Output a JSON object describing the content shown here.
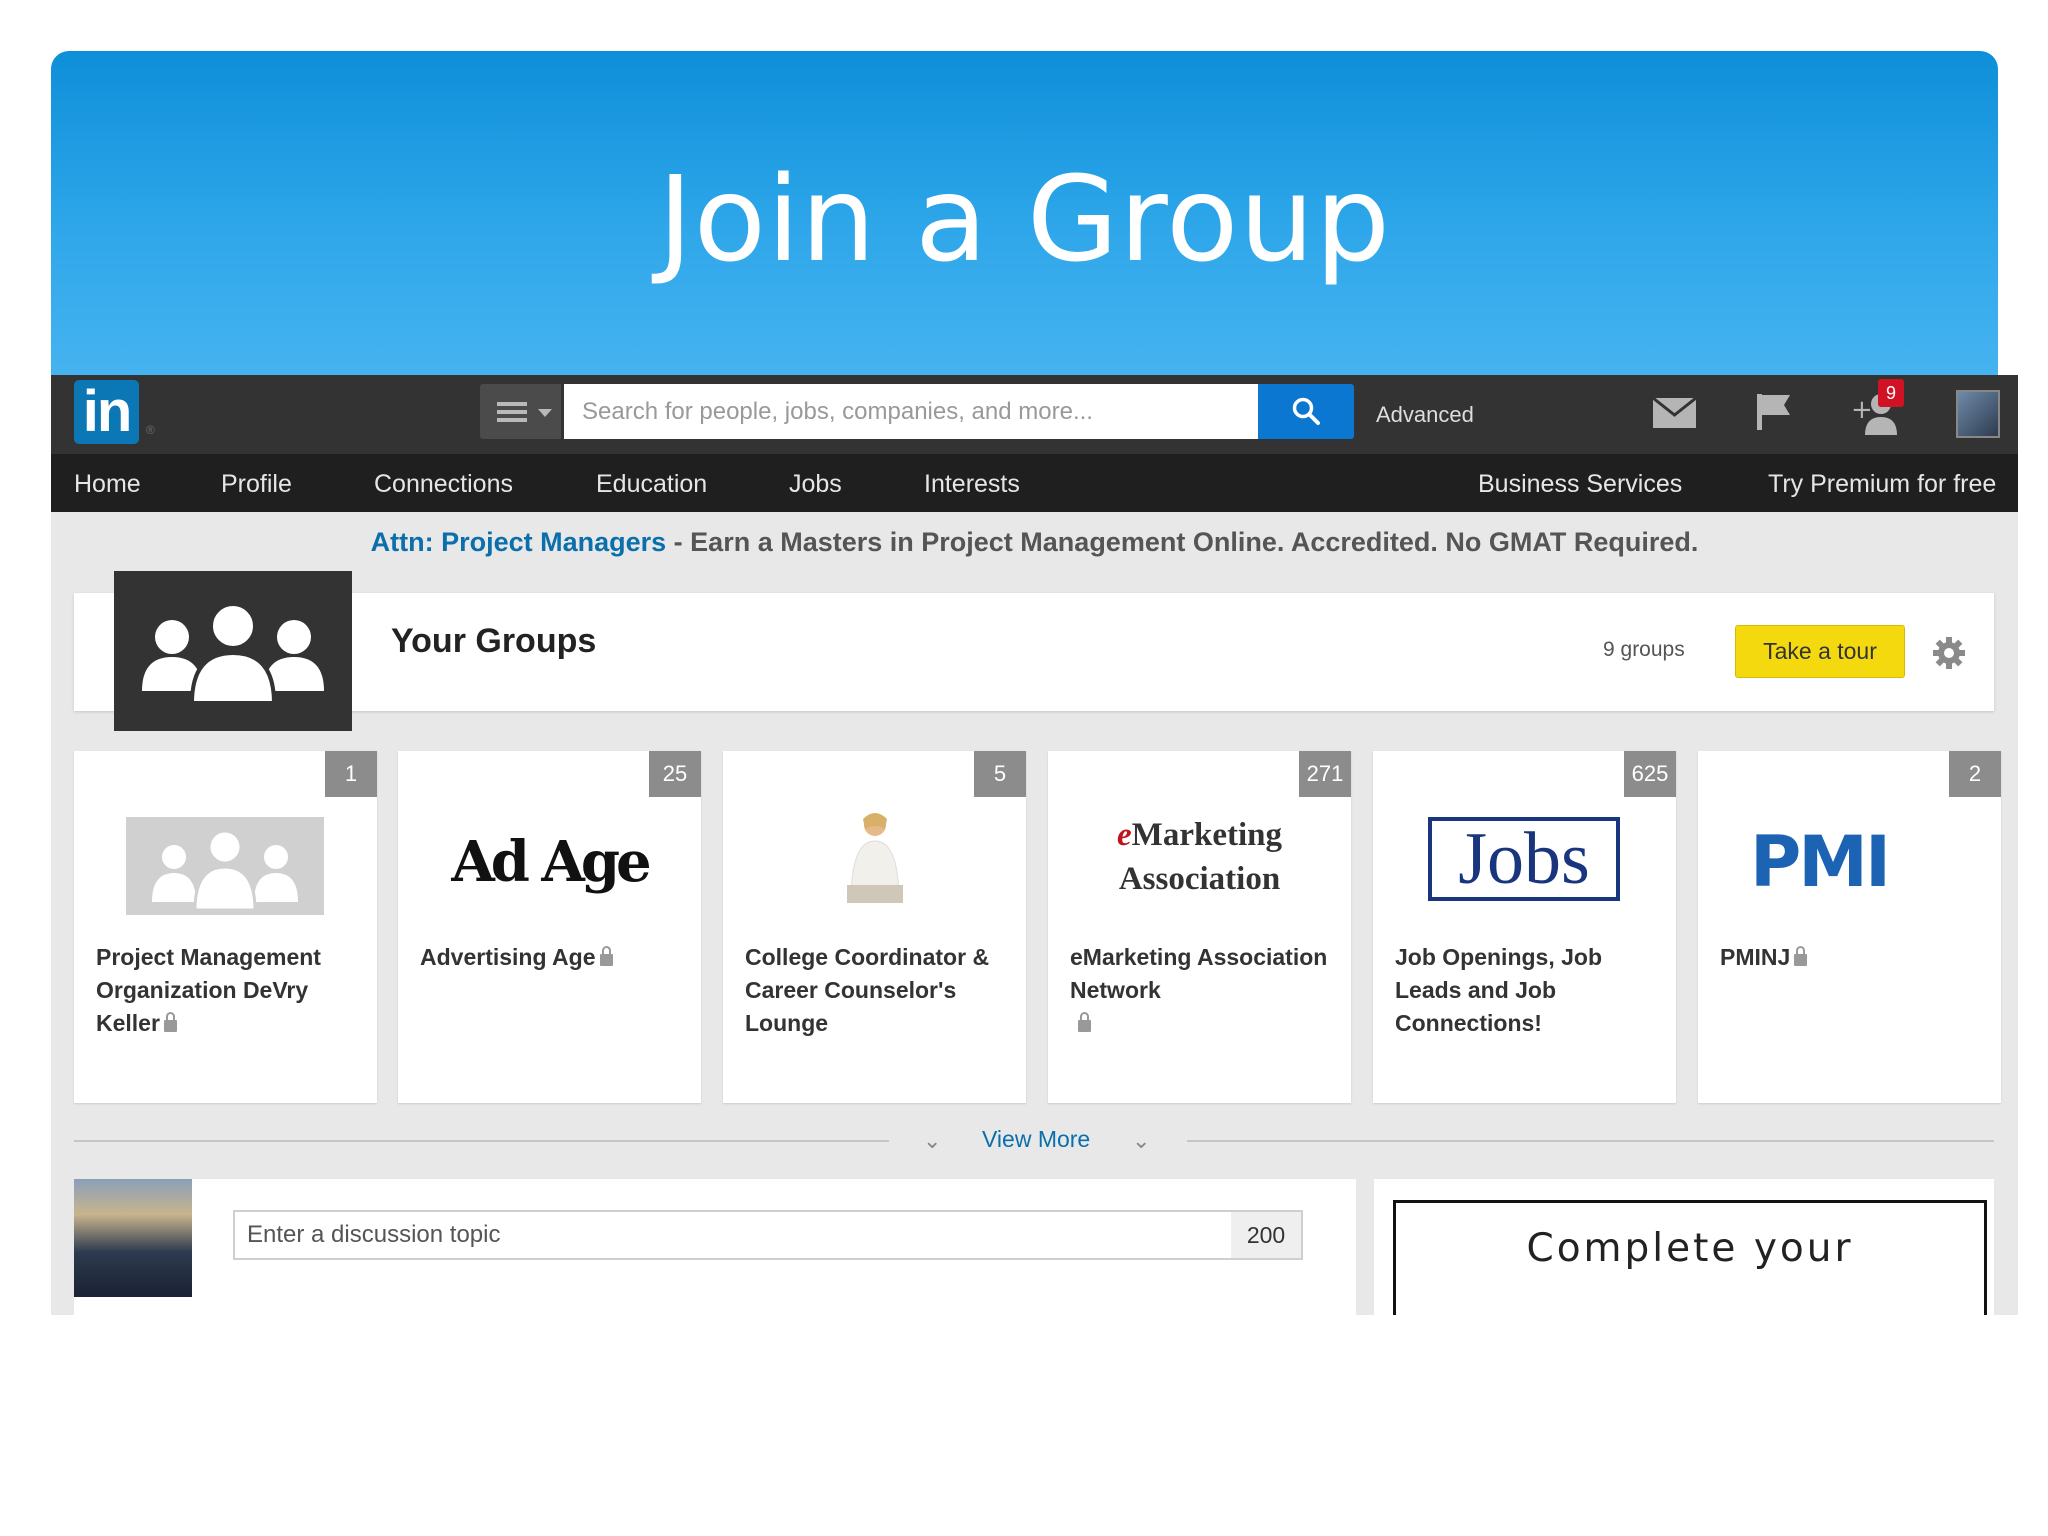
{
  "slide": {
    "title": "Join a Group"
  },
  "topbar": {
    "logo": "in",
    "logo_mark": "®",
    "search_placeholder": "Search for people, jobs, companies, and more...",
    "advanced_label": "Advanced",
    "notification_count": "9",
    "icons": [
      "menu-icon",
      "search-icon",
      "mail-icon",
      "flag-icon",
      "add-connection-icon",
      "profile-avatar"
    ]
  },
  "nav": {
    "home": "Home",
    "profile": "Profile",
    "connections": "Connections",
    "education": "Education",
    "jobs": "Jobs",
    "interests": "Interests",
    "business_services": "Business Services",
    "premium": "Try Premium for free"
  },
  "promo": {
    "link": "Attn: Project Managers",
    "text": " - Earn a Masters in Project Management Online. Accredited. No GMAT Required."
  },
  "groups": {
    "title": "Your Groups",
    "count_label": "9 groups",
    "tour_label": "Take a tour",
    "cards": [
      {
        "count": "1",
        "name": "Project Management Organization DeVry Keller",
        "locked": true,
        "logo": "group-placeholder"
      },
      {
        "count": "25",
        "name": "Advertising Age",
        "locked": true,
        "logo_text": "Ad Age"
      },
      {
        "count": "5",
        "name": "College Coordinator & Career Counselor's Lounge",
        "locked": false,
        "logo": "person-photo"
      },
      {
        "count": "271",
        "name": "eMarketing Association Network",
        "locked": true,
        "logo_text_a": "e",
        "logo_text_b": "Marketing",
        "logo_text_c": "Association"
      },
      {
        "count": "625",
        "name": "Job Openings, Job Leads and Job Connections!",
        "locked": false,
        "logo_text": "Jobs"
      },
      {
        "count": "2",
        "name": "PMINJ",
        "locked": true,
        "logo_text": "PMI"
      }
    ],
    "view_more": "View More"
  },
  "discussion": {
    "placeholder": "Enter a discussion topic",
    "char_limit": "200"
  },
  "sidebar": {
    "complete_text": "Complete your"
  },
  "colors": {
    "banner": "#1a9be3",
    "linkedin_blue": "#0b77b5",
    "tour_yellow": "#f5d90f",
    "link": "#0b6fab"
  }
}
